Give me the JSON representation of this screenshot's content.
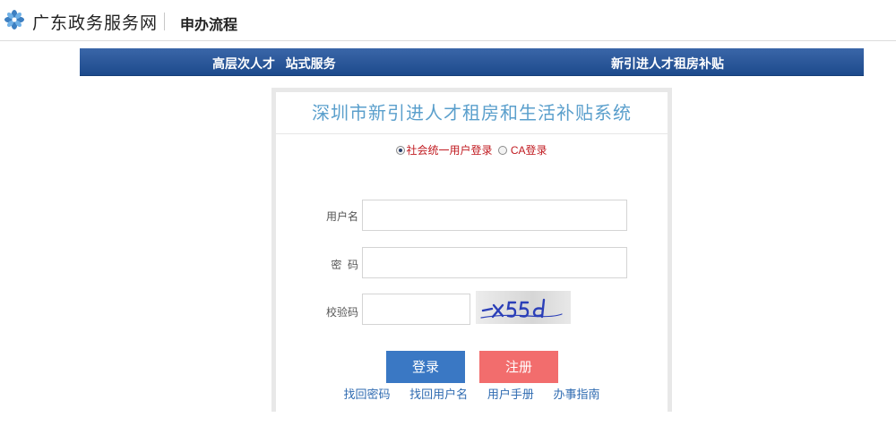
{
  "header": {
    "site_name": "广东政务服务网",
    "page_tag": "申办流程",
    "logo_icon": "guangdong-flower-logo"
  },
  "banner": {
    "left_text": "高层次人才   站式服务",
    "right_text": "新引进人才租房补贴",
    "color": "#1d4a8c"
  },
  "panel": {
    "title": "深圳市新引进人才租房和生活补贴系统",
    "title_color": "#5a9fcc",
    "login_types": [
      {
        "label": "社会统一用户登录",
        "selected": true
      },
      {
        "label": "CA登录",
        "selected": false
      }
    ],
    "fields": {
      "username_label": "用户名",
      "password_label": "密  码",
      "captcha_label": "校验码"
    },
    "captcha_text": "xx55d",
    "buttons": {
      "login": "登录",
      "register": "注册",
      "login_color": "#3a78c4",
      "register_color": "#f26d6d"
    },
    "links": [
      "找回密码",
      "找回用户名",
      "用户手册",
      "办事指南"
    ]
  }
}
